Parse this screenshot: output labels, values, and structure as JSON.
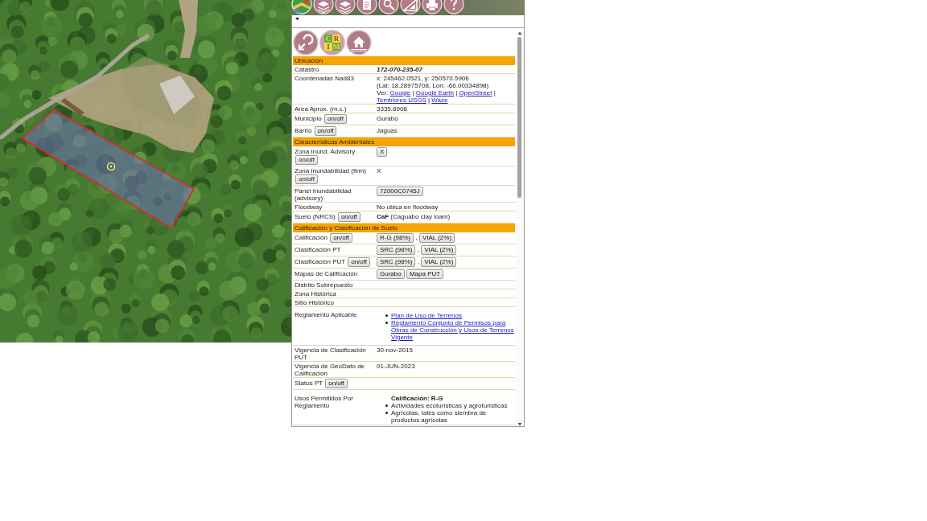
{
  "logo": {
    "letters": [
      "C",
      "R",
      "I",
      "M"
    ]
  },
  "sections": [
    {
      "title": "Ubicación",
      "rows": [
        {
          "label": "Catastro",
          "lines": [
            [
              {
                "kind": "emphasis",
                "text": "172-070-235-07"
              }
            ]
          ]
        },
        {
          "label": "Coordenadas Nad83",
          "lines": [
            [
              {
                "kind": "text",
                "text": "x: 245462.0521, y: 250570.5906"
              }
            ],
            [
              {
                "kind": "text",
                "text": "(Lat: 18.28975708, Lon: -66.00334898)"
              }
            ],
            [
              {
                "kind": "text",
                "text": "Ver:"
              },
              {
                "kind": "link",
                "text": "Google"
              },
              {
                "kind": "text",
                "text": "|"
              },
              {
                "kind": "link",
                "text": "Google Earth"
              },
              {
                "kind": "text",
                "text": "|"
              },
              {
                "kind": "link",
                "text": "OpenStreet"
              },
              {
                "kind": "text",
                "text": "|"
              },
              {
                "kind": "link",
                "text": "Temblores USGS"
              },
              {
                "kind": "text",
                "text": "|"
              },
              {
                "kind": "link",
                "text": "Waze"
              }
            ]
          ]
        },
        {
          "label": "Area Aprox. (m.c.)",
          "lines": [
            [
              {
                "kind": "text",
                "text": "3335.8908"
              }
            ]
          ]
        },
        {
          "label": "Municipio",
          "toggle": "on/off",
          "lines": [
            [
              {
                "kind": "text",
                "text": "Gurabo"
              }
            ]
          ]
        },
        {
          "label": "Barrio",
          "toggle": "on/off",
          "lines": [
            [
              {
                "kind": "text",
                "text": "Jaguas"
              }
            ]
          ]
        }
      ]
    },
    {
      "title": "Características Ambientales",
      "rows": [
        {
          "label": "Zona Inund. Advisory",
          "toggle": "on/off",
          "lines": [
            [
              {
                "kind": "button",
                "text": "X"
              }
            ]
          ]
        },
        {
          "label": "Zona Inundabilidad (firm)",
          "toggle": "on/off",
          "lines": [
            [
              {
                "kind": "text",
                "text": "X"
              }
            ]
          ]
        },
        {
          "label": "Panel Inundabilidad (advisory)",
          "lines": [
            [
              {
                "kind": "button",
                "text": "72000C0745J"
              }
            ]
          ]
        },
        {
          "label": "Floodway",
          "lines": [
            [
              {
                "kind": "text",
                "text": "No ubica en floodway"
              }
            ]
          ]
        },
        {
          "label": "Suelo (NRCS)",
          "toggle": "on/off",
          "lines": [
            [
              {
                "kind": "text",
                "text": "**CaF** (Caguabo clay loam)"
              }
            ]
          ]
        }
      ]
    },
    {
      "title": "Calificación y Clasificación de Suelo",
      "rows": [
        {
          "label": "Calificación",
          "toggle": "on/off",
          "lines": [
            [
              {
                "kind": "button",
                "text": "R-G (98%)"
              },
              {
                "kind": "text",
                "text": ","
              },
              {
                "kind": "button",
                "text": "VIAL (2%)"
              }
            ]
          ]
        },
        {
          "label": "Clasificación PT",
          "lines": [
            [
              {
                "kind": "button",
                "text": "SRC (98%)"
              },
              {
                "kind": "text",
                "text": ","
              },
              {
                "kind": "button",
                "text": "VIAL (2%)"
              }
            ]
          ]
        },
        {
          "label": "Clasificación PUT",
          "toggle": "on/off",
          "lines": [
            [
              {
                "kind": "button",
                "text": "SRC (98%)"
              },
              {
                "kind": "text",
                "text": ","
              },
              {
                "kind": "button",
                "text": "VIAL (2%)"
              }
            ]
          ]
        },
        {
          "label": "Mapas de Calificación",
          "lines": [
            [
              {
                "kind": "button",
                "text": "Gurabo"
              },
              {
                "kind": "button",
                "text": "Mapa PUT"
              }
            ]
          ]
        },
        {
          "label": "Distrito Sobrepuesto"
        },
        {
          "label": "Zona Histórica"
        },
        {
          "label": "Sitio Histórico"
        },
        {
          "label": "Reglamento Aplicable",
          "bullets": [
            {
              "kind": "link",
              "text": "Plan de Uso de Terrenos"
            },
            {
              "kind": "link",
              "text": "Reglamento Conjunto de Permisos para Obras de Construcción y Usos de Terrenos Vigente"
            }
          ]
        },
        {
          "label": "Vigencia de Clasificación PUT",
          "lines": [
            [
              {
                "kind": "text",
                "text": "30-nov-2015"
              }
            ]
          ]
        },
        {
          "label": "Vigencia de GeoDato de Calificación",
          "lines": [
            [
              {
                "kind": "text",
                "text": "01-JUN-2023"
              }
            ]
          ]
        },
        {
          "label": "Status PT",
          "toggle": "on/off"
        },
        {
          "label": "Usos Permitidos Por Reglamento",
          "heading": "Calificación: R-G",
          "bullets": [
            {
              "kind": "text",
              "text": "Actividades ecoturísticas y agroturísticas"
            },
            {
              "kind": "text",
              "text": "Agrícolas, tales como siembra de productos agrícolas"
            }
          ]
        }
      ]
    }
  ]
}
